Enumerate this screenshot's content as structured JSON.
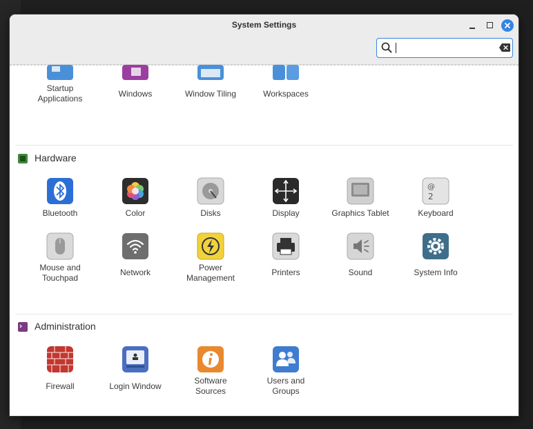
{
  "window": {
    "title": "System Settings"
  },
  "search": {
    "value": "",
    "placeholder": ""
  },
  "top_row": [
    {
      "label_lines": [
        "Startup",
        "Applications"
      ]
    },
    {
      "label_lines": [
        "Windows"
      ]
    },
    {
      "label_lines": [
        "Window Tiling"
      ]
    },
    {
      "label_lines": [
        "Workspaces"
      ]
    }
  ],
  "hardware": {
    "title": "Hardware",
    "items": [
      {
        "label_lines": [
          "Bluetooth"
        ],
        "icon": "bluetooth-icon"
      },
      {
        "label_lines": [
          "Color"
        ],
        "icon": "color-icon"
      },
      {
        "label_lines": [
          "Disks"
        ],
        "icon": "disks-icon"
      },
      {
        "label_lines": [
          "Display"
        ],
        "icon": "display-icon"
      },
      {
        "label_lines": [
          "Graphics Tablet"
        ],
        "icon": "graphics-tablet-icon"
      },
      {
        "label_lines": [
          "Keyboard"
        ],
        "icon": "keyboard-icon"
      },
      {
        "label_lines": [
          "Mouse and",
          "Touchpad"
        ],
        "icon": "mouse-icon"
      },
      {
        "label_lines": [
          "Network"
        ],
        "icon": "network-icon"
      },
      {
        "label_lines": [
          "Power",
          "Management"
        ],
        "icon": "power-icon"
      },
      {
        "label_lines": [
          "Printers"
        ],
        "icon": "printer-icon"
      },
      {
        "label_lines": [
          "Sound"
        ],
        "icon": "sound-icon"
      },
      {
        "label_lines": [
          "System Info"
        ],
        "icon": "system-info-icon"
      }
    ]
  },
  "administration": {
    "title": "Administration",
    "items": [
      {
        "label_lines": [
          "Firewall"
        ],
        "icon": "firewall-icon"
      },
      {
        "label_lines": [
          "Login Window"
        ],
        "icon": "login-window-icon"
      },
      {
        "label_lines": [
          "Software",
          "Sources"
        ],
        "icon": "software-sources-icon"
      },
      {
        "label_lines": [
          "Users and",
          "Groups"
        ],
        "icon": "users-groups-icon"
      }
    ]
  },
  "colors": {
    "accent": "#3584e4",
    "hardware_badge": "#3d8a3a",
    "admin_badge": "#7a3b80"
  }
}
